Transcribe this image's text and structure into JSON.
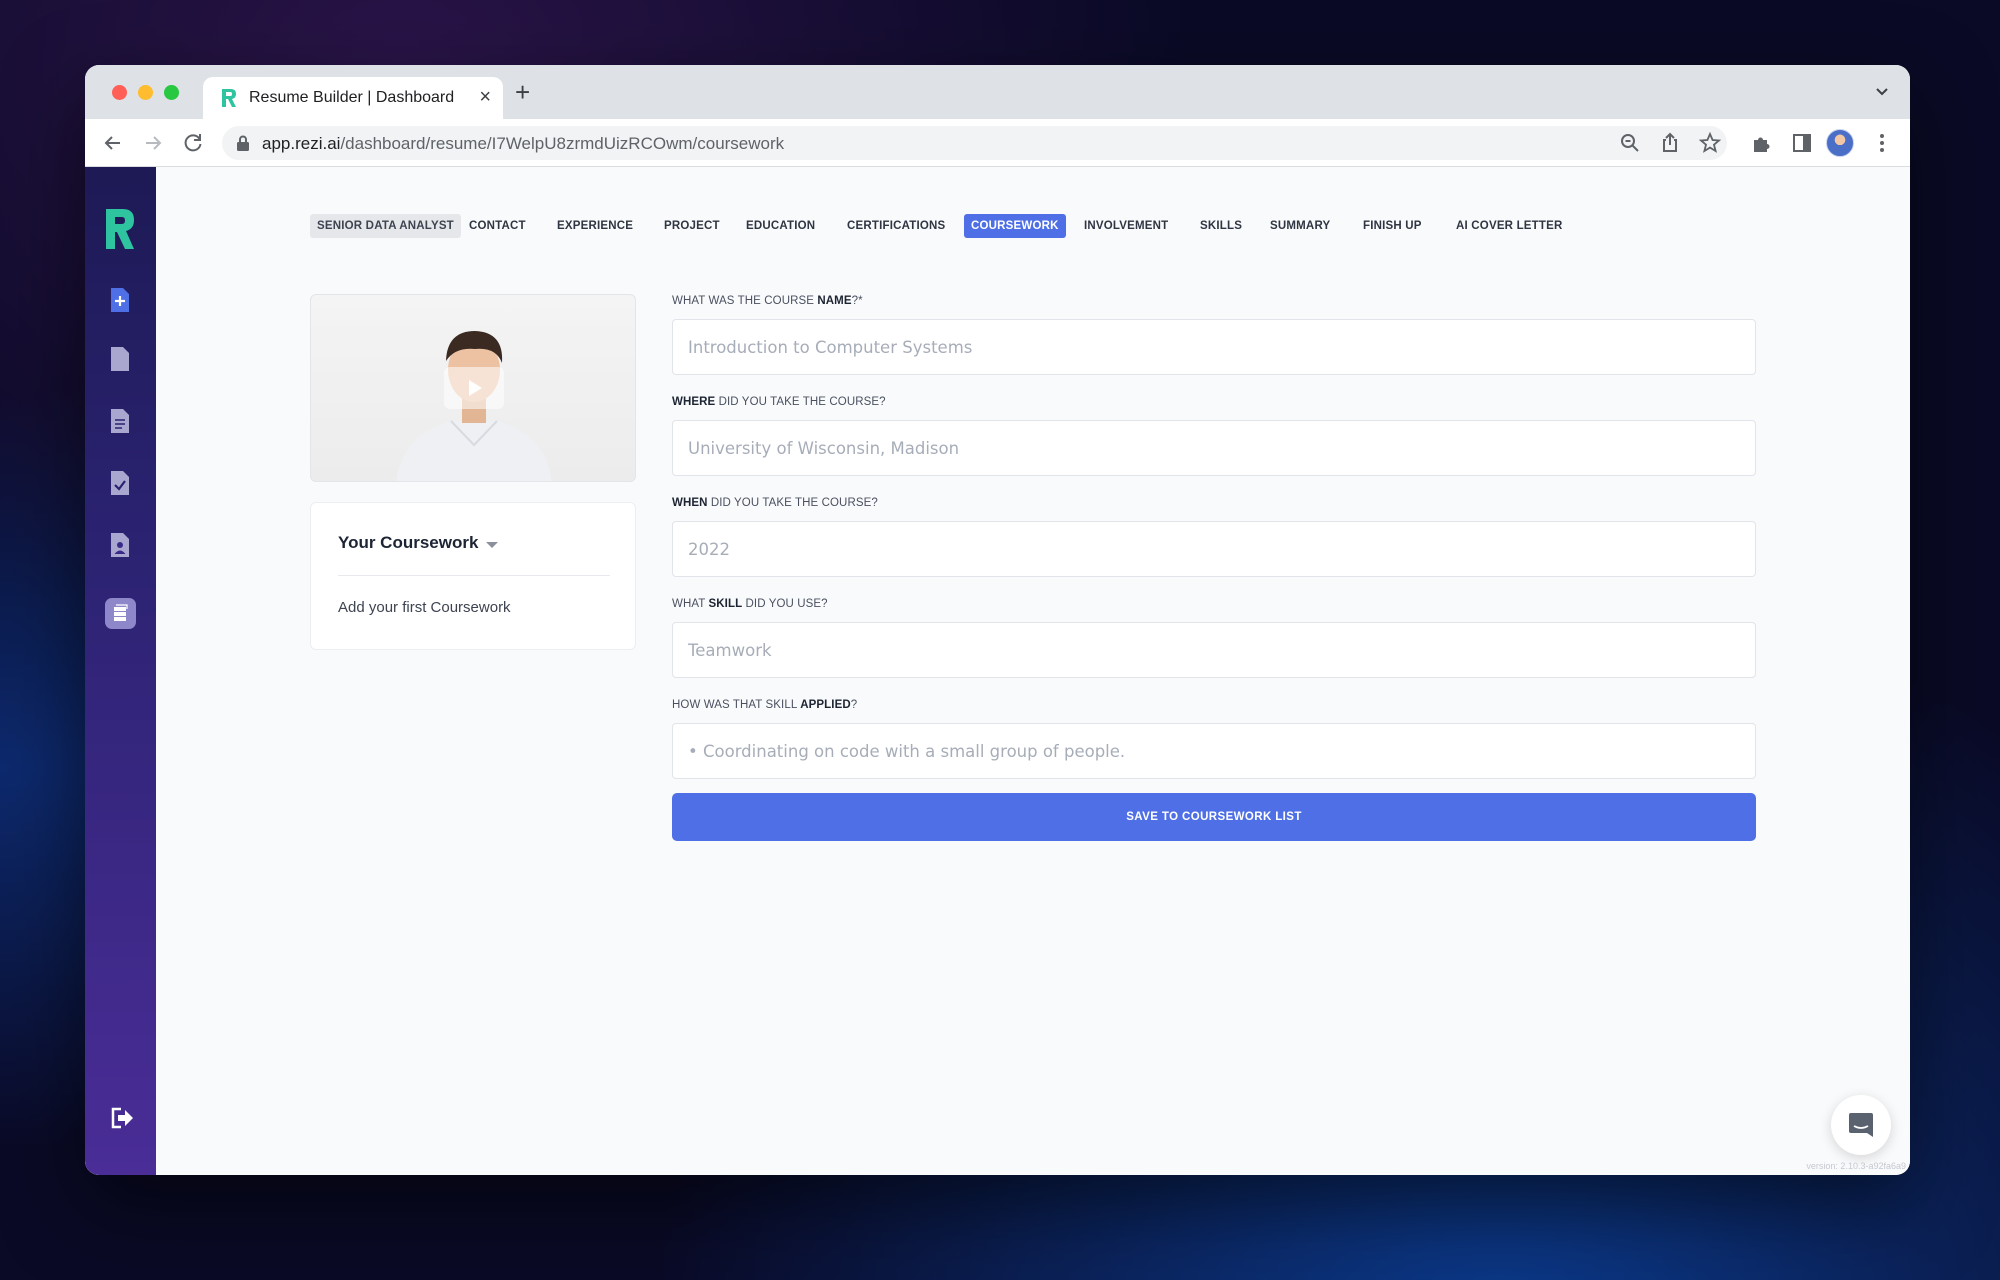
{
  "browser": {
    "tab_title": "Resume Builder | Dashboard",
    "url_host": "app.rezi.ai",
    "url_path": "/dashboard/resume/I7WelpU8zrmdUizRCOwm/coursework"
  },
  "nav": {
    "resume_name": "SENIOR DATA ANALYST",
    "items": [
      "CONTACT",
      "EXPERIENCE",
      "PROJECT",
      "EDUCATION",
      "CERTIFICATIONS",
      "COURSEWORK",
      "INVOLVEMENT",
      "SKILLS",
      "SUMMARY",
      "FINISH UP",
      "AI COVER LETTER"
    ],
    "active": "COURSEWORK"
  },
  "coursework_panel": {
    "title": "Your Coursework",
    "empty_text": "Add your first Coursework"
  },
  "form": {
    "course_name": {
      "label_pre": "WHAT WAS THE COURSE ",
      "label_bold": "NAME",
      "label_post": "?*",
      "placeholder": "Introduction to Computer Systems",
      "value": ""
    },
    "where": {
      "label_pre": "",
      "label_bold": "WHERE",
      "label_post": " DID YOU TAKE THE COURSE?",
      "placeholder": "University of Wisconsin, Madison",
      "value": ""
    },
    "when": {
      "label_pre": "",
      "label_bold": "WHEN",
      "label_post": " DID YOU TAKE THE COURSE?",
      "placeholder": "2022",
      "value": ""
    },
    "skill": {
      "label_pre": "WHAT ",
      "label_bold": "SKILL",
      "label_post": " DID YOU USE?",
      "placeholder": "Teamwork",
      "value": ""
    },
    "applied": {
      "label_pre": "HOW WAS THAT SKILL ",
      "label_bold": "APPLIED",
      "label_post": "?",
      "placeholder": "• Coordinating on code with a small group of people.",
      "value": ""
    },
    "save_label": "SAVE TO COURSEWORK LIST"
  },
  "version": "version: 2.10.3-a92fa6a9",
  "colors": {
    "accent": "#4f6fe6",
    "sidebar_top": "#1d1a55",
    "sidebar_bottom": "#4a2d97",
    "logo": "#2ec4a0"
  },
  "icons": {
    "sidebar": [
      "logo-icon",
      "new-resume-icon",
      "document-icon",
      "document-lines-icon",
      "document-check-icon",
      "document-person-icon",
      "coursework-stack-icon",
      "logout-icon"
    ],
    "video": "play-icon",
    "chat": "chat-icon"
  }
}
